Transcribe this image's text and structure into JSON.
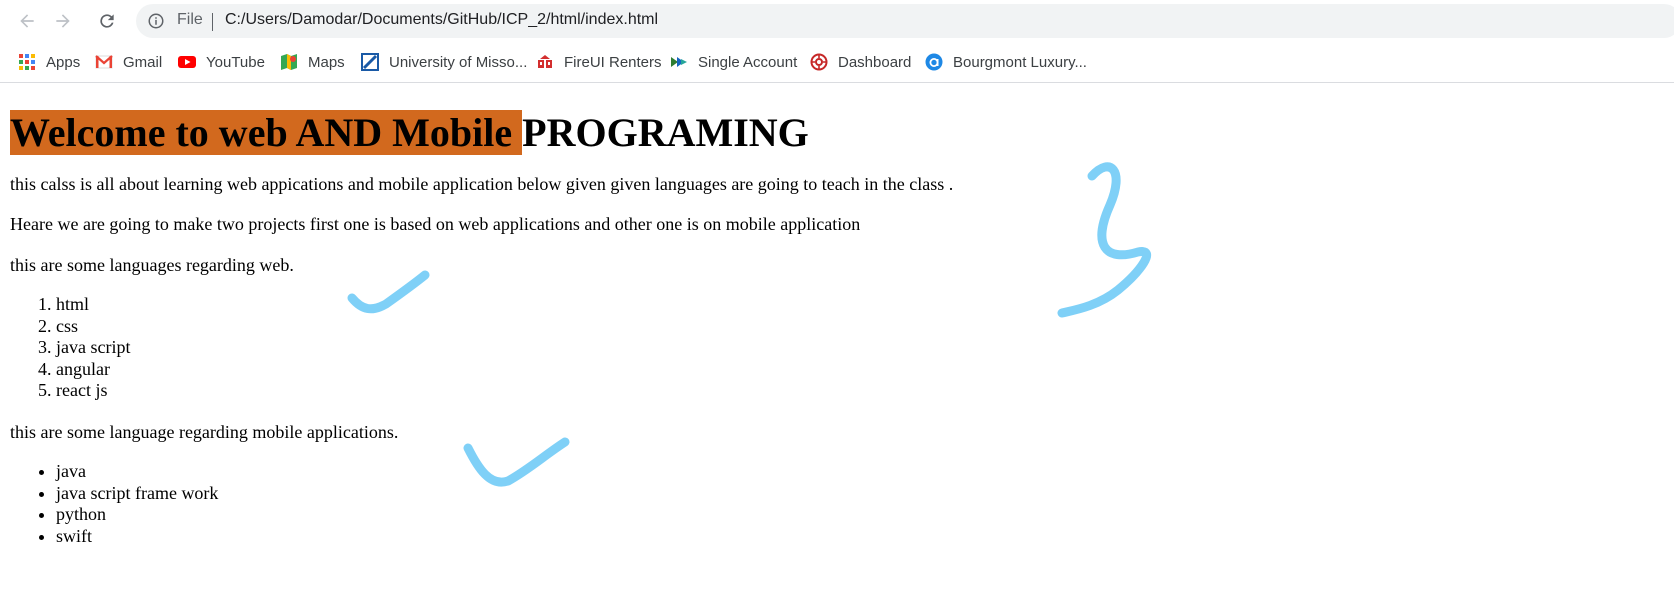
{
  "browser": {
    "url_scheme": "File",
    "url": "C:/Users/Damodar/Documents/GitHub/ICP_2/html/index.html",
    "bookmarks": [
      {
        "label": "Apps",
        "icon": "apps-grid-icon"
      },
      {
        "label": "Gmail",
        "icon": "gmail-icon"
      },
      {
        "label": "YouTube",
        "icon": "youtube-icon"
      },
      {
        "label": "Maps",
        "icon": "maps-icon"
      },
      {
        "label": "University of Misso...",
        "icon": "university-icon"
      },
      {
        "label": "FireUI Renters",
        "icon": "fireui-icon"
      },
      {
        "label": "Single Account",
        "icon": "single-account-icon"
      },
      {
        "label": "Dashboard",
        "icon": "dashboard-icon"
      },
      {
        "label": "Bourgmont Luxury...",
        "icon": "bourgmont-icon"
      }
    ]
  },
  "page": {
    "heading_highlight": "Welcome to web AND Mobile",
    "heading_rest": "PROGRAMING",
    "intro": "this calss is all about learning web appications and mobile application below given given languages are going to teach in the class .",
    "projects": "Heare we are going to make two projects first one is based on web applications and other one is on mobile application",
    "web_intro": "this are some languages regarding web.",
    "web_languages": [
      "html",
      "css",
      "java script",
      "angular",
      "react js"
    ],
    "mobile_intro": "this are some language regarding mobile applications.",
    "mobile_languages": [
      "java",
      "java script frame work",
      "python",
      "swift"
    ]
  },
  "colors": {
    "heading_highlight": "#d2691e",
    "annotation_ink": "#7fd0f7",
    "omnibox": "#f1f3f4"
  }
}
